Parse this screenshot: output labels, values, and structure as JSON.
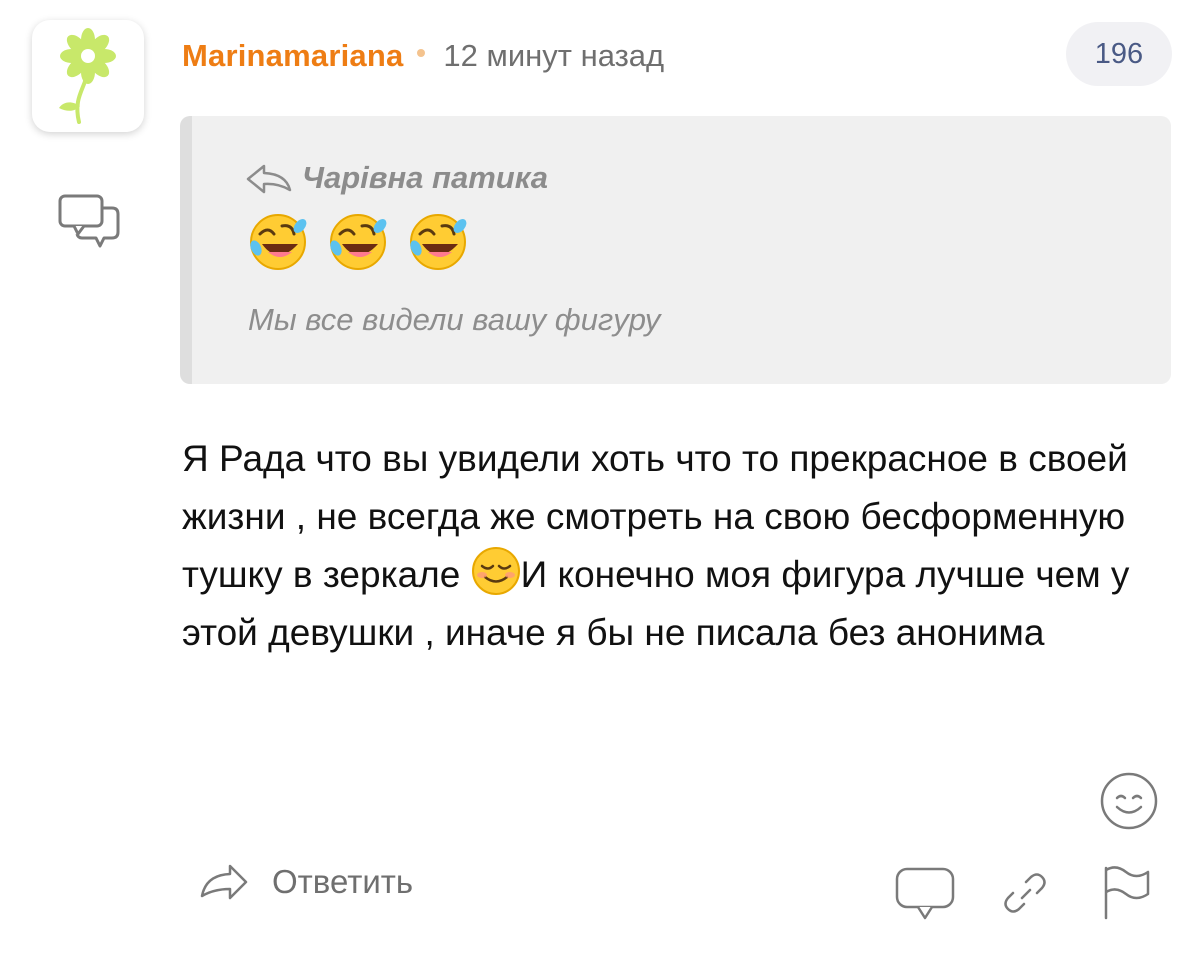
{
  "comment": {
    "author": "Marinamariana",
    "time": "12 минут назад",
    "rating": "196",
    "text_before_emoji": "Я Рада что вы увидели хоть что то прекрасное в своей жизни , не всегда же смотреть на свою бесформенную тушку в зеркале ",
    "text_after_emoji": "И конечно моя фигура лучше чем у этой девушки , иначе я бы не писала без анонима",
    "inline_emoji": "smiling-face-icon"
  },
  "quote": {
    "author": "Чарівна патика",
    "emojis": [
      "rolling-on-floor-laughing-icon",
      "rolling-on-floor-laughing-icon",
      "rolling-on-floor-laughing-icon"
    ],
    "text": "Мы все видели вашу фигуру"
  },
  "actions": {
    "reply_label": "Ответить"
  },
  "colors": {
    "author": "#ee7d14",
    "badge_bg": "#f1f1f4",
    "quote_bg": "#f0f0f0",
    "muted": "#6f6f6f",
    "avatar_flower": "#c8e86a"
  }
}
